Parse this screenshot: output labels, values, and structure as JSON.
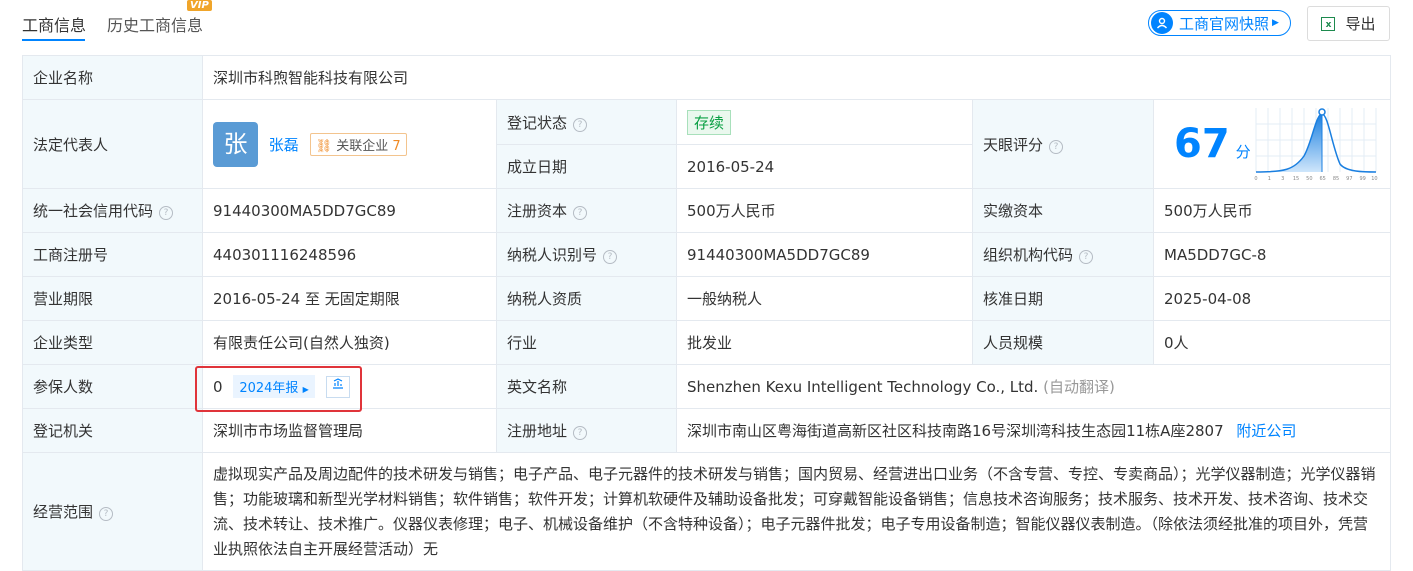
{
  "tabs": [
    {
      "label": "工商信息",
      "active": true
    },
    {
      "label": "历史工商信息",
      "active": false
    }
  ],
  "vip_badge": "VIP",
  "toolbar": {
    "snapshot_label": "工商官网快照",
    "export_label": "导出"
  },
  "company": {
    "name_label": "企业名称",
    "name": "深圳市科煦智能科技有限公司",
    "legal_rep_label": "法定代表人",
    "legal_rep_avatar": "张",
    "legal_rep_name": "张磊",
    "related_label": "关联企业",
    "related_count": "7",
    "reg_status_label": "登记状态",
    "reg_status": "存续",
    "founded_label": "成立日期",
    "founded": "2016-05-24",
    "score_label": "天眼评分",
    "score": "67",
    "score_unit": "分",
    "credit_code_label": "统一社会信用代码",
    "credit_code": "91440300MA5DD7GC89",
    "reg_capital_label": "注册资本",
    "reg_capital": "500万人民币",
    "paid_capital_label": "实缴资本",
    "paid_capital": "500万人民币",
    "reg_no_label": "工商注册号",
    "reg_no": "440301116248596",
    "taxpayer_id_label": "纳税人识别号",
    "taxpayer_id": "91440300MA5DD7GC89",
    "org_code_label": "组织机构代码",
    "org_code": "MA5DD7GC-8",
    "term_label": "营业期限",
    "term": "2016-05-24 至 无固定期限",
    "taxpayer_qual_label": "纳税人资质",
    "taxpayer_qual": "一般纳税人",
    "approval_date_label": "核准日期",
    "approval_date": "2025-04-08",
    "type_label": "企业类型",
    "type": "有限责任公司(自然人独资)",
    "industry_label": "行业",
    "industry": "批发业",
    "staff_size_label": "人员规模",
    "staff_size": "0人",
    "insured_label": "参保人数",
    "insured": "0",
    "annual_report": "2024年报",
    "english_name_label": "英文名称",
    "english_name": "Shenzhen Kexu Intelligent Technology Co., Ltd.",
    "auto_translate": "(自动翻译)",
    "authority_label": "登记机关",
    "authority": "深圳市市场监督管理局",
    "address_label": "注册地址",
    "address": "深圳市南山区粤海街道高新区社区科技南路16号深圳湾科技生态园11栋A座2807",
    "nearby_link": "附近公司",
    "scope_label": "经营范围",
    "scope": "虚拟现实产品及周边配件的技术研发与销售；电子产品、电子元器件的技术研发与销售；国内贸易、经营进出口业务（不含专营、专控、专卖商品）；光学仪器制造；光学仪器销售；功能玻璃和新型光学材料销售；软件销售；软件开发；计算机软硬件及辅助设备批发；可穿戴智能设备销售；信息技术咨询服务；技术服务、技术开发、技术咨询、技术交流、技术转让、技术推广。仪器仪表修理；电子、机械设备维护（不含特种设备）；电子元器件批发；电子专用设备制造；智能仪器仪表制造。（除依法须经批准的项目外，凭营业执照依法自主开展经营活动）无"
  },
  "score_chart": {
    "ticks": [
      "0",
      "1",
      "3",
      "15",
      "50",
      "65",
      "85",
      "97",
      "99",
      "100"
    ]
  },
  "colors": {
    "accent": "#0084ff",
    "label_bg": "#f2f9fc",
    "status_green": "#0a9f43",
    "highlight": "#e0343a"
  }
}
